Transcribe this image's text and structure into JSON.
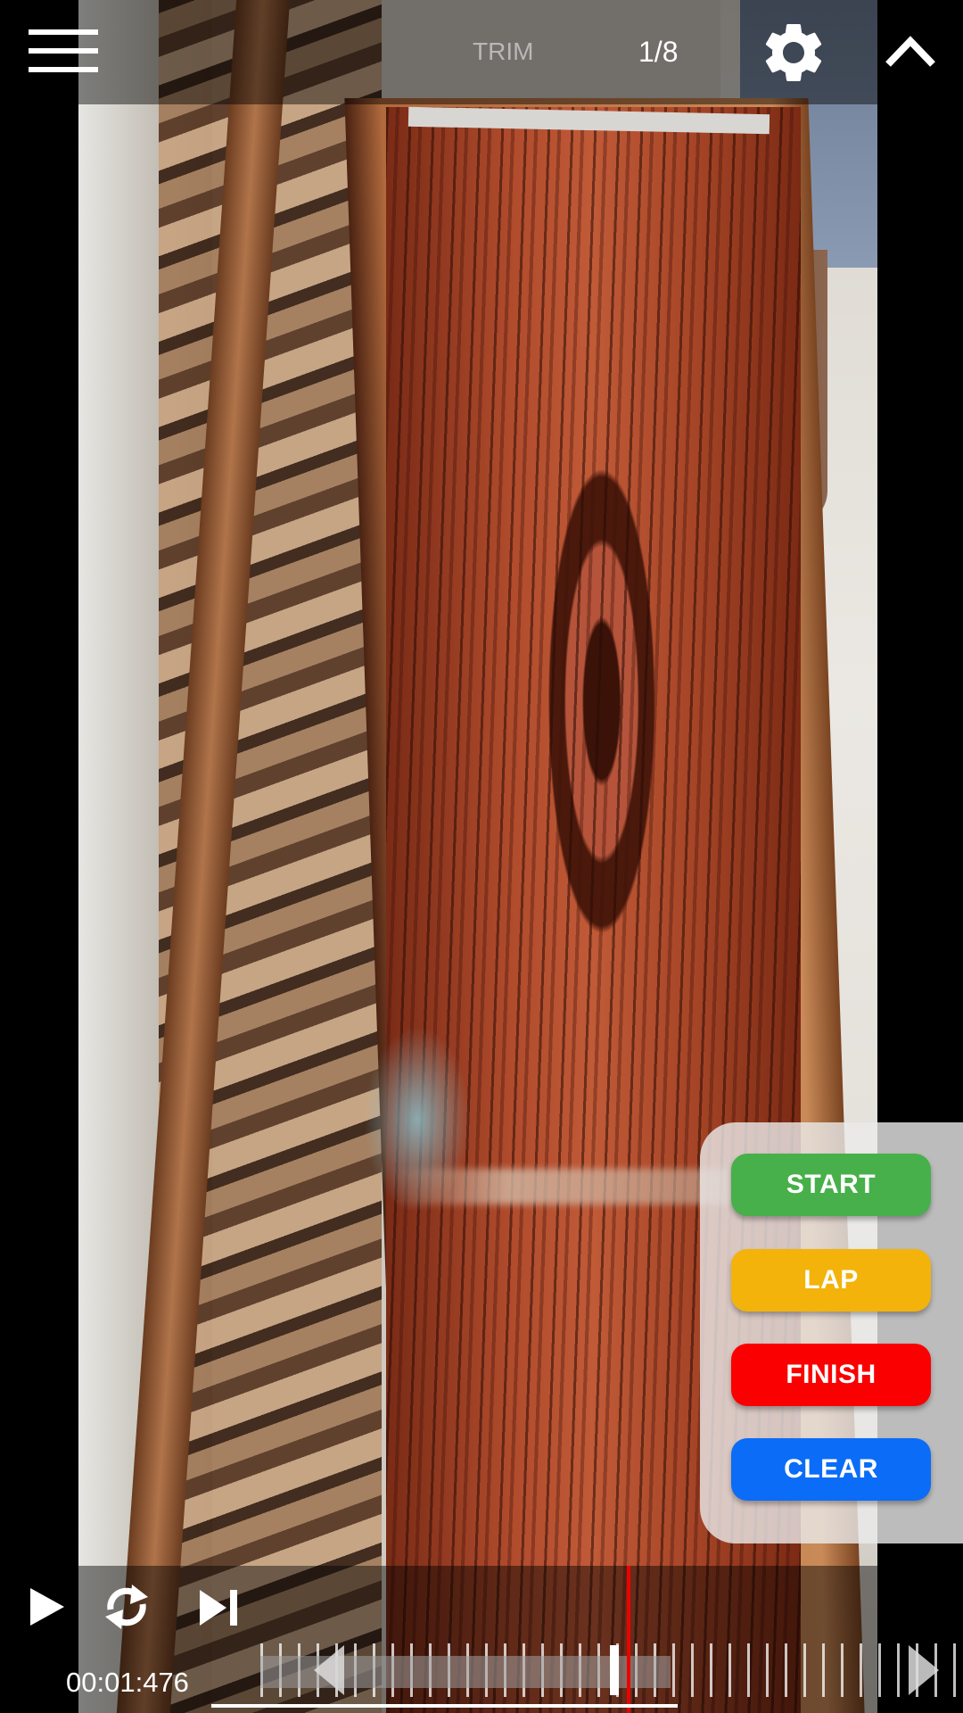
{
  "topbar": {
    "trim_label": "TRIM",
    "counter": "1/8",
    "icons": [
      "menu-icon",
      "gear-icon",
      "chevron-up-icon"
    ]
  },
  "timer_panel": {
    "start_label": "START",
    "lap_label": "LAP",
    "finish_label": "FINISH",
    "clear_label": "CLEAR",
    "colors": {
      "start": "#47b04b",
      "lap": "#f3b30b",
      "finish": "#fa0000",
      "clear": "#0b6cf7"
    }
  },
  "playback": {
    "icons": [
      "play-icon",
      "loop-icon",
      "skip-next-icon"
    ],
    "time": "00:01:476",
    "playhead_color": "#ee0000"
  }
}
